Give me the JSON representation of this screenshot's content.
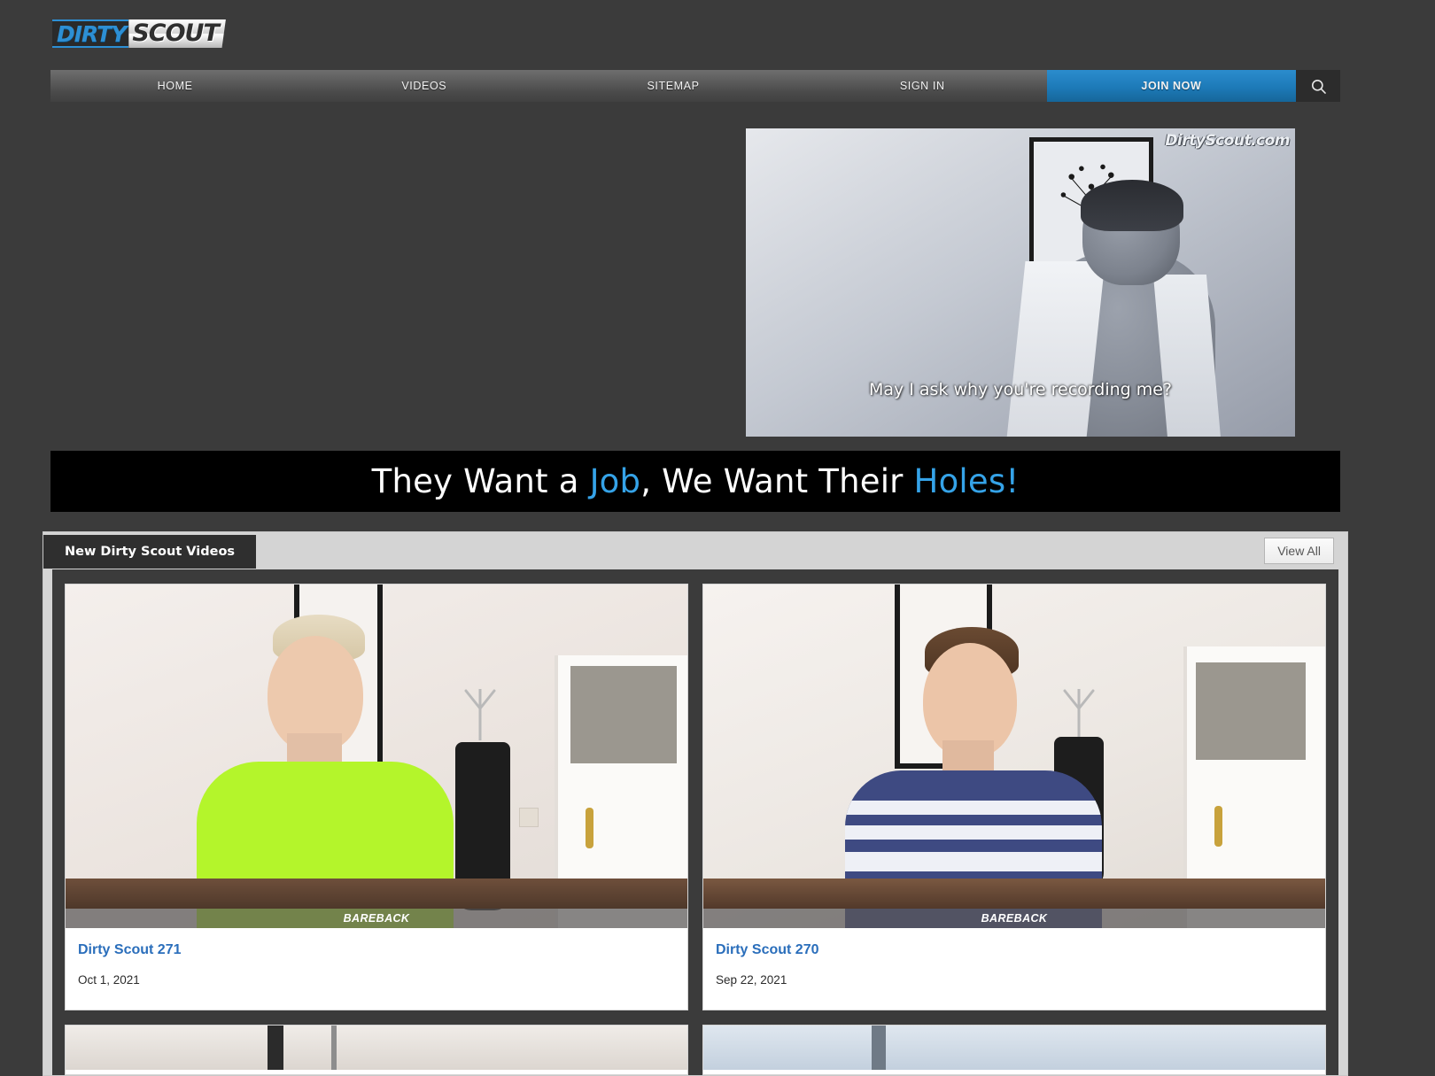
{
  "site": {
    "logo_primary": "DIRTY",
    "logo_secondary": "SCOUT",
    "accent_blue": "#2d8fd4",
    "join_blue": "#1d7ab8",
    "link_blue": "#2a6ebb"
  },
  "nav": {
    "items": [
      {
        "label": "HOME",
        "style": "normal"
      },
      {
        "label": "VIDEOS",
        "style": "normal"
      },
      {
        "label": "SITEMAP",
        "style": "normal"
      },
      {
        "label": "SIGN IN",
        "style": "normal"
      },
      {
        "label": "JOIN NOW",
        "style": "cta"
      }
    ],
    "search_icon": "search-icon"
  },
  "hero": {
    "watermark": "DirtyScout.com",
    "subtitle": "May I ask why you're recording me?"
  },
  "tagline": {
    "part1": "They Want a ",
    "highlight1": "Job",
    "part2": ", We Want Their ",
    "highlight2": "Holes!",
    "full": "They Want a Job, We Want Their Holes!"
  },
  "section": {
    "title": "New Dirty Scout Videos",
    "view_all_label": "View All"
  },
  "videos": [
    {
      "title": "Dirty Scout 271",
      "date": "Oct 1, 2021",
      "tag": "BAREBACK"
    },
    {
      "title": "Dirty Scout 270",
      "date": "Sep 22, 2021",
      "tag": "BAREBACK"
    }
  ]
}
